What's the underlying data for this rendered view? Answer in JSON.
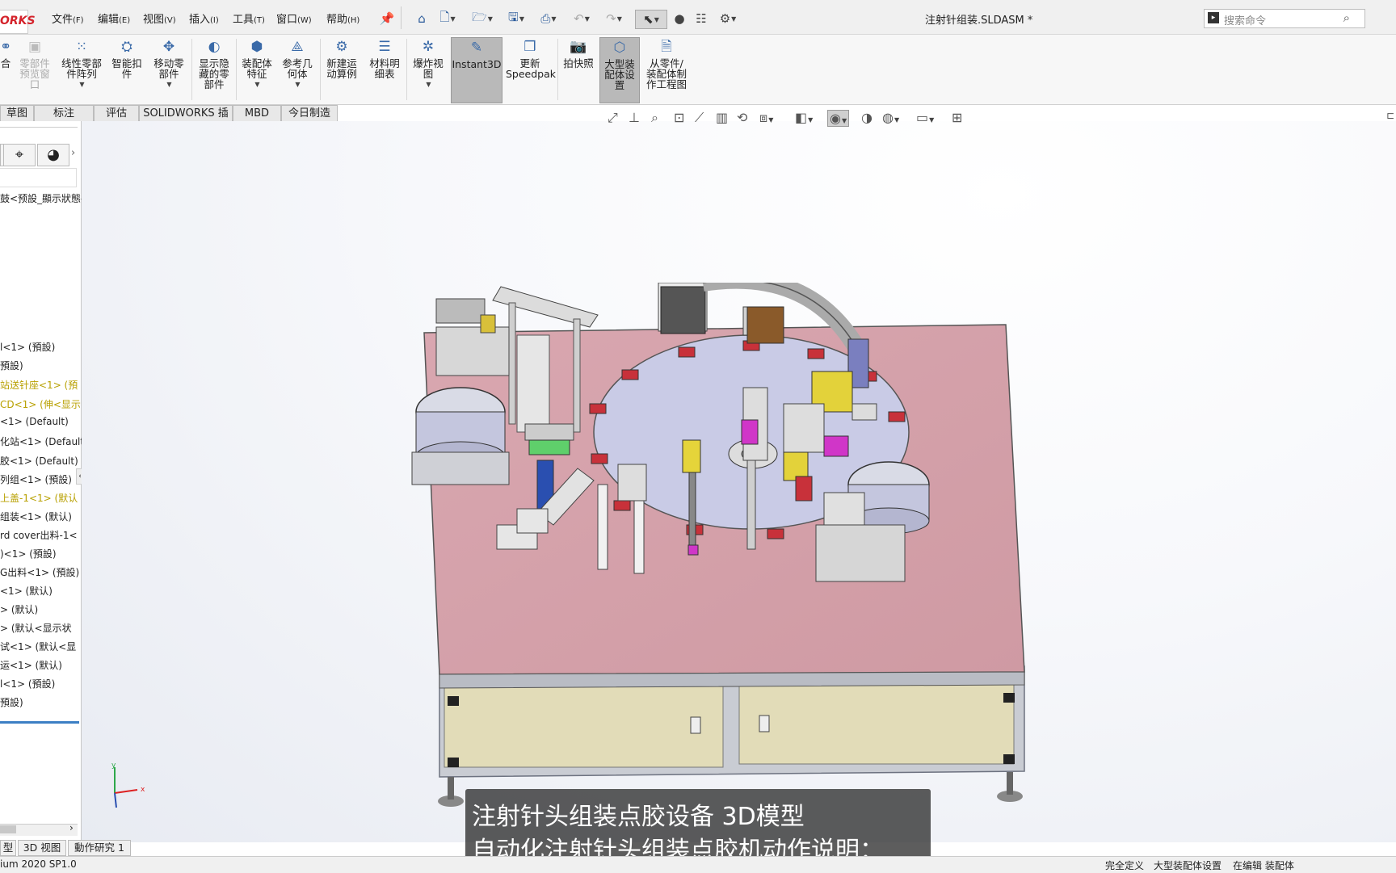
{
  "app": {
    "logo_text": "ORKS",
    "document_title": "注射针组装.SLDASM *",
    "accent_color": "#d4232b"
  },
  "menu": [
    {
      "label": "文件",
      "key": "(F)"
    },
    {
      "label": "编辑",
      "key": "(E)"
    },
    {
      "label": "视图",
      "key": "(V)"
    },
    {
      "label": "插入",
      "key": "(I)"
    },
    {
      "label": "工具",
      "key": "(T)"
    },
    {
      "label": "窗口",
      "key": "(W)"
    },
    {
      "label": "帮助",
      "key": "(H)"
    }
  ],
  "quick_access_icons": [
    "pin-icon",
    "home-icon",
    "new-document-icon",
    "open-icon",
    "save-icon",
    "print-icon",
    "undo-icon",
    "redo-icon",
    "select-icon",
    "traffic-light-icon",
    "options-list-icon",
    "settings-gear-icon"
  ],
  "search": {
    "placeholder": "搜索命令"
  },
  "ribbon": [
    {
      "label": "合",
      "icon": "mate-icon"
    },
    {
      "label": "零部件\n预览窗\n口",
      "icon": "preview-window-icon",
      "disabled": true
    },
    {
      "label": "线性零部\n件阵列",
      "icon": "linear-pattern-icon"
    },
    {
      "label": "智能扣\n件",
      "icon": "smart-fastener-icon"
    },
    {
      "label": "移动零\n部件",
      "icon": "move-component-icon"
    },
    {
      "label": "显示隐\n藏的零\n部件",
      "icon": "show-hidden-icon"
    },
    {
      "label": "装配体\n特征",
      "icon": "assembly-feature-icon"
    },
    {
      "label": "参考几\n何体",
      "icon": "reference-geometry-icon"
    },
    {
      "label": "新建运\n动算例",
      "icon": "motion-study-icon"
    },
    {
      "label": "材料明\n细表",
      "icon": "bom-icon"
    },
    {
      "label": "爆炸视\n图",
      "icon": "exploded-view-icon"
    },
    {
      "label": "Instant3D",
      "icon": "instant3d-icon",
      "active": true
    },
    {
      "label": "更新\nSpeedpak",
      "icon": "speedpak-icon"
    },
    {
      "label": "拍快照",
      "icon": "snapshot-icon"
    },
    {
      "label": "大型装\n配体设\n置",
      "icon": "large-assembly-icon",
      "active": true
    },
    {
      "label": "从零件/\n装配体制\n作工程图",
      "icon": "make-drawing-icon"
    }
  ],
  "tabs": [
    "草图",
    "标注",
    "评估",
    "SOLIDWORKS 插件",
    "MBD",
    "今日制造"
  ],
  "feature_tree": [
    {
      "text": "鼓<预設_顯示狀態-",
      "style": "normal"
    },
    {
      "text": "l<1> (預設)",
      "style": "normal"
    },
    {
      "text": "預設)",
      "style": "normal"
    },
    {
      "text": "站送针座<1> (預",
      "style": "yellow"
    },
    {
      "text": "CD<1> (伸<显示",
      "style": "yellow"
    },
    {
      "text": "<1> (Default)",
      "style": "normal"
    },
    {
      "text": "化站<1> (Default",
      "style": "normal"
    },
    {
      "text": "胶<1> (Default)",
      "style": "normal"
    },
    {
      "text": "列组<1> (預設)",
      "style": "normal"
    },
    {
      "text": "上盖-1<1> (默认",
      "style": "yellow"
    },
    {
      "text": "组装<1> (默认)",
      "style": "normal"
    },
    {
      "text": "rd cover出料-1<",
      "style": "normal"
    },
    {
      "text": ")<1> (預設)",
      "style": "normal"
    },
    {
      "text": "G出料<1> (預設)",
      "style": "normal"
    },
    {
      "text": "<1> (默认)",
      "style": "normal"
    },
    {
      "text": "> (默认)",
      "style": "normal"
    },
    {
      "text": "> (默认<显示状",
      "style": "normal"
    },
    {
      "text": "试<1> (默认<显",
      "style": "normal"
    },
    {
      "text": "运<1> (默认)",
      "style": "normal"
    },
    {
      "text": "l<1> (預設)",
      "style": "normal"
    },
    {
      "text": "預設)",
      "style": "normal"
    }
  ],
  "bottom_tabs": [
    "型",
    "3D 视图",
    "動作研究 1"
  ],
  "status": {
    "version": "ium 2020 SP1.0",
    "items": [
      "完全定义",
      "大型装配体设置",
      "在编辑 装配体"
    ]
  },
  "subtitle": {
    "line1": "注射针头组装点胶设备 3D模型",
    "line2": "自动化注射针头组装点胶机动作说明："
  },
  "colors": {
    "table_top": "#d8a6ad",
    "rotary_dial": "#c9cbe6",
    "cabinet_panel": "#e2dcb8",
    "frame": "#c9ccd3"
  }
}
